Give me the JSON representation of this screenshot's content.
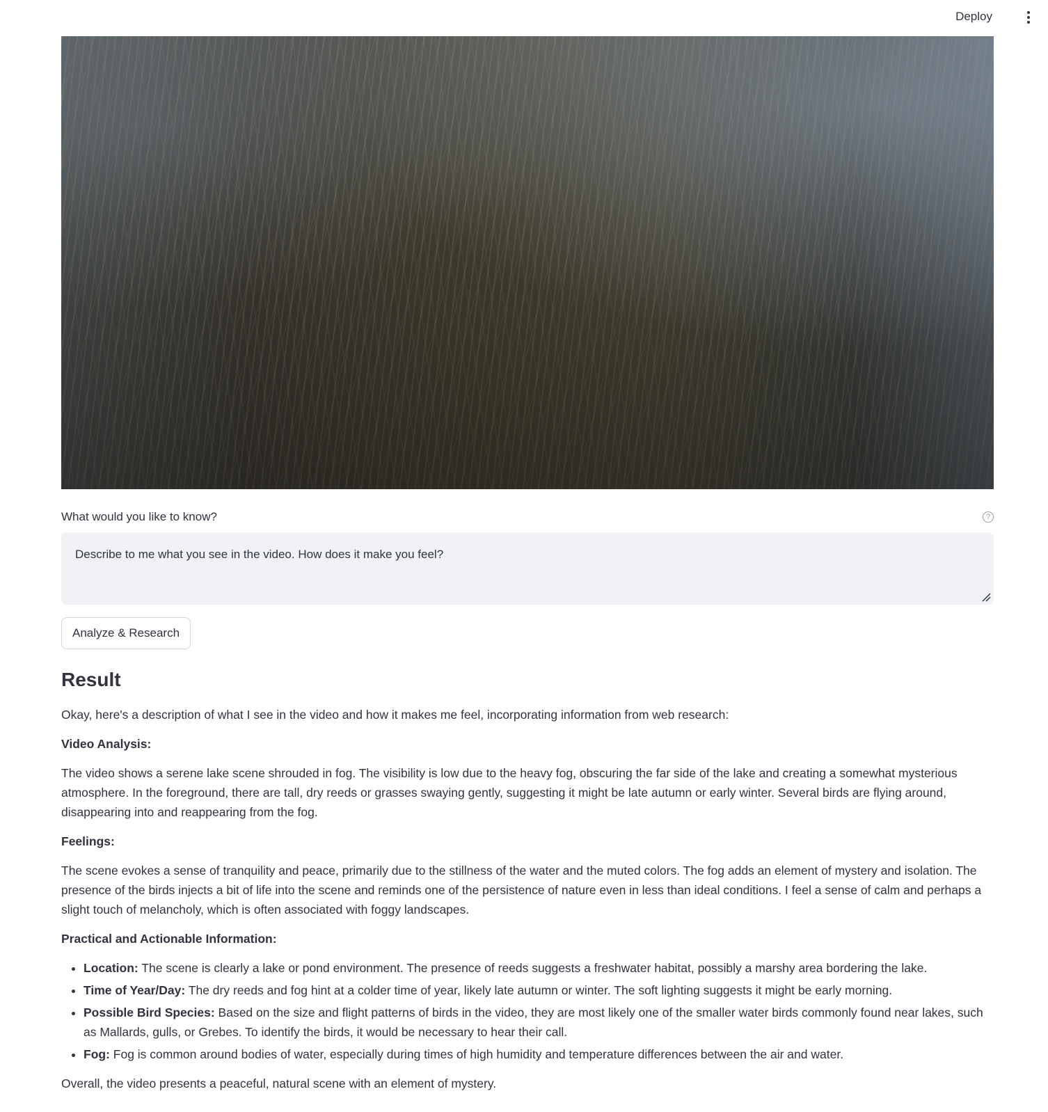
{
  "header": {
    "deploy_label": "Deploy",
    "menu_icon": "more-vertical-icon"
  },
  "video": {
    "icon": "video-frame"
  },
  "question": {
    "label": "What would you like to know?",
    "help_icon": "question-circle-icon",
    "value": "Describe to me what you see in the video. How does it make you feel?"
  },
  "analyze_button": {
    "label": "Analyze & Research"
  },
  "result": {
    "title": "Result",
    "intro": "Okay, here's a description of what I see in the video and how it makes me feel, incorporating information from web research:",
    "video_analysis_heading": "Video Analysis:",
    "video_analysis_text": "The video shows a serene lake scene shrouded in fog. The visibility is low due to the heavy fog, obscuring the far side of the lake and creating a somewhat mysterious atmosphere. In the foreground, there are tall, dry reeds or grasses swaying gently, suggesting it might be late autumn or early winter. Several birds are flying around, disappearing into and reappearing from the fog.",
    "feelings_heading": "Feelings:",
    "feelings_text": "The scene evokes a sense of tranquility and peace, primarily due to the stillness of the water and the muted colors. The fog adds an element of mystery and isolation. The presence of the birds injects a bit of life into the scene and reminds one of the persistence of nature even in less than ideal conditions. I feel a sense of calm and perhaps a slight touch of melancholy, which is often associated with foggy landscapes.",
    "practical_heading": "Practical and Actionable Information:",
    "items": [
      {
        "label": "Location:",
        "text": " The scene is clearly a lake or pond environment. The presence of reeds suggests a freshwater habitat, possibly a marshy area bordering the lake."
      },
      {
        "label": "Time of Year/Day:",
        "text": " The dry reeds and fog hint at a colder time of year, likely late autumn or winter. The soft lighting suggests it might be early morning."
      },
      {
        "label": "Possible Bird Species:",
        "text": " Based on the size and flight patterns of birds in the video, they are most likely one of the smaller water birds commonly found near lakes, such as Mallards, gulls, or Grebes. To identify the birds, it would be necessary to hear their call."
      },
      {
        "label": "Fog:",
        "text": " Fog is common around bodies of water, especially during times of high humidity and temperature differences between the air and water."
      }
    ],
    "conclusion": "Overall, the video presents a peaceful, natural scene with an element of mystery."
  }
}
